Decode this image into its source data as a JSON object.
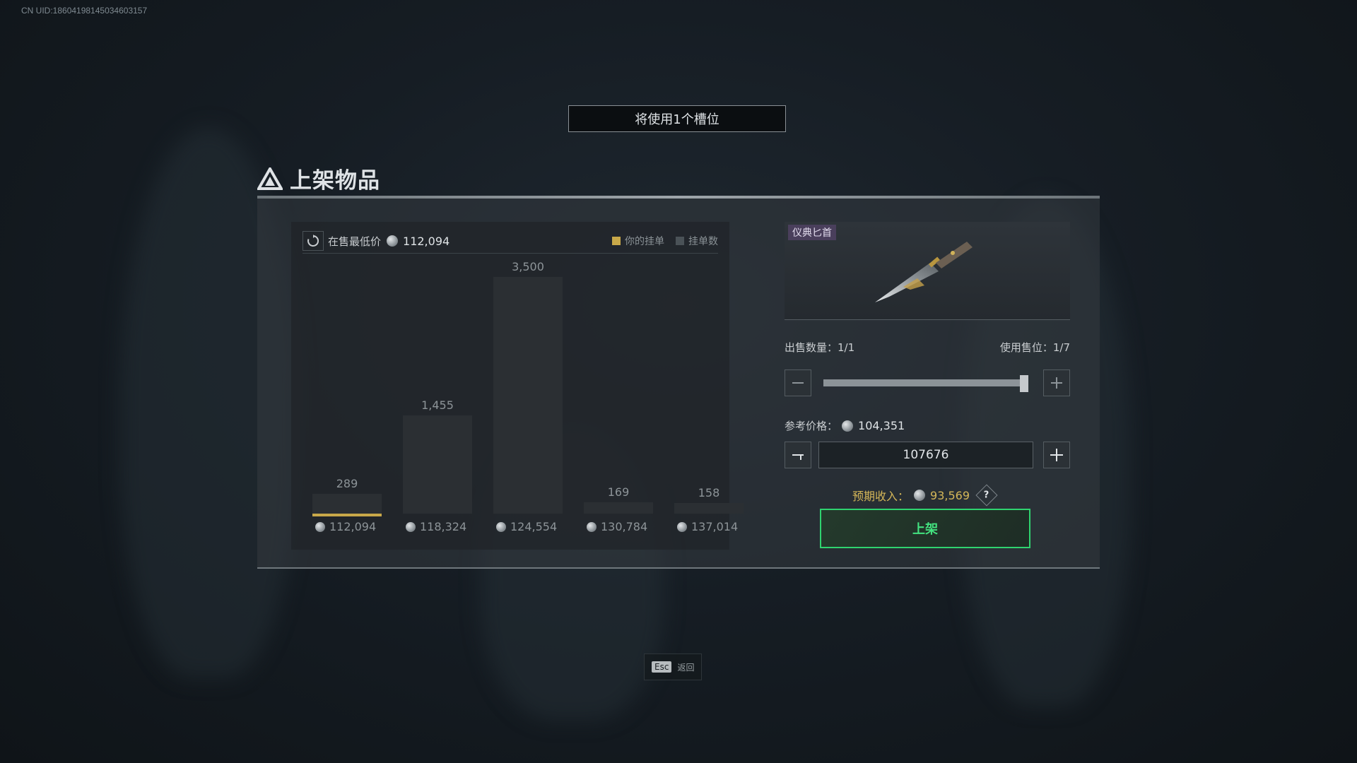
{
  "uid_text": "CN UID:18604198145034603157",
  "slot_banner": "将使用1个槽位",
  "title": "上架物品",
  "chart": {
    "lowest_label": "在售最低价",
    "lowest_value": "112,094",
    "legend_mine": "你的挂单",
    "legend_orders": "挂单数",
    "mine_color": "#c8a849",
    "orders_color": "#4a5257"
  },
  "chart_data": {
    "type": "bar",
    "categories": [
      "112,094",
      "118,324",
      "124,554",
      "130,784",
      "137,014"
    ],
    "values": [
      289,
      1455,
      3500,
      169,
      158
    ],
    "value_labels": [
      "289",
      "1,455",
      "3,500",
      "169",
      "158"
    ],
    "highlight_index": 0,
    "series": [
      {
        "name": "挂单数",
        "values": [
          289,
          1455,
          3500,
          169,
          158
        ]
      }
    ]
  },
  "item": {
    "name": "仪典匕首"
  },
  "sell": {
    "qty_label": "出售数量：1/1",
    "slots_label": "使用售位：1/7",
    "qty_fraction": 1.0,
    "ref_label": "参考价格：",
    "ref_value": "104,351",
    "price_input": "107676",
    "income_label": "预期收入：",
    "income_value": "93,569",
    "help": "?",
    "list_button": "上架"
  },
  "esc": {
    "key": "Esc",
    "label": "返回"
  }
}
